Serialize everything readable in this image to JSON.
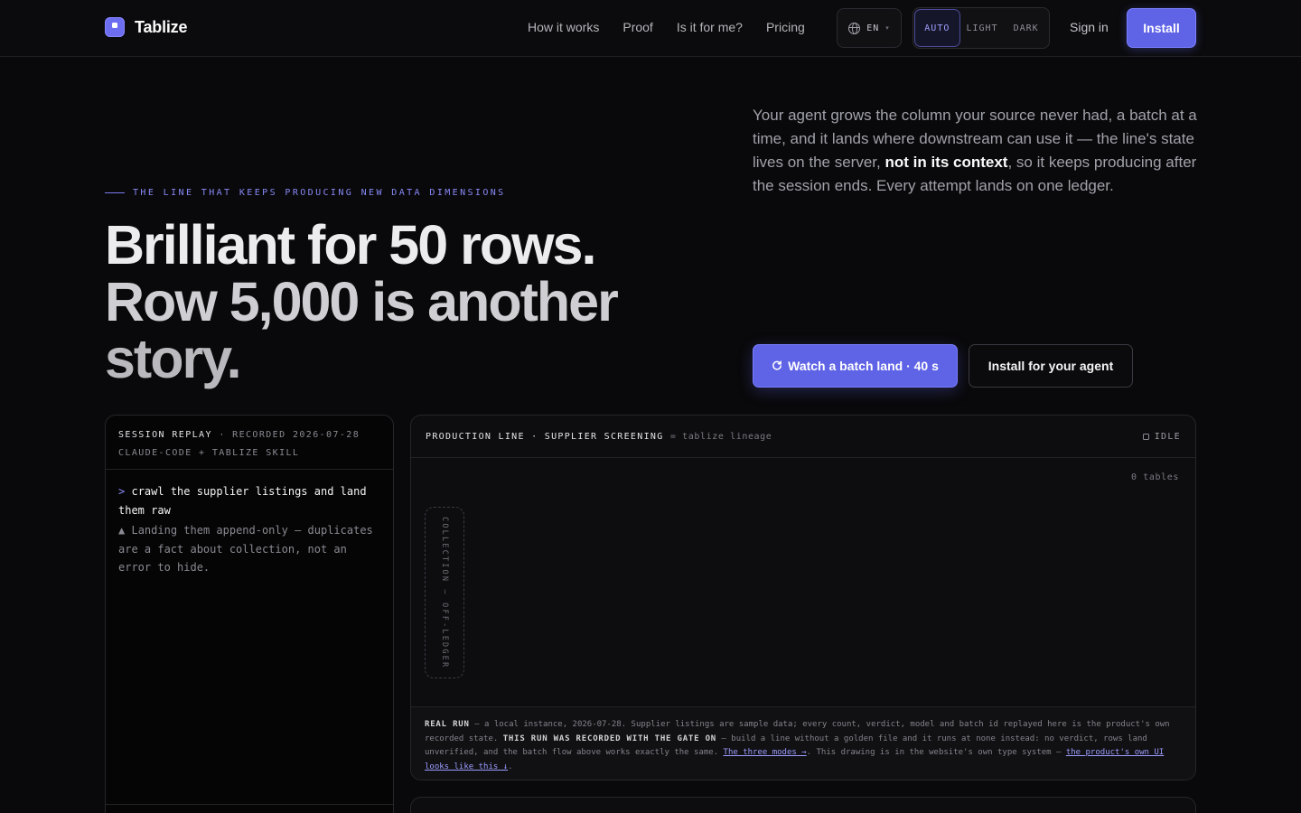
{
  "header": {
    "brand": "Tablize",
    "nav": [
      "How it works",
      "Proof",
      "Is it for me?",
      "Pricing"
    ],
    "language": "EN",
    "theme_options": [
      "AUTO",
      "LIGHT",
      "DARK"
    ],
    "theme_selected": "AUTO",
    "sign_in": "Sign in",
    "install": "Install"
  },
  "hero": {
    "eyebrow": "THE LINE THAT KEEPS PRODUCING NEW DATA DIMENSIONS",
    "headline": [
      "Brilliant for 50 rows.",
      "Row 5,000 is another",
      "story."
    ],
    "lede_before": "Your agent grows the column your source never had, a batch at a time, and it lands where downstream can use it — the line's state lives on the server, ",
    "lede_bold": "not in its context",
    "lede_after": ", so it keeps producing after the session ends. Every attempt lands on one ledger.",
    "cta_primary": "Watch a batch land · 40 s",
    "cta_secondary": "Install for your agent"
  },
  "session": {
    "label": "SESSION REPLAY",
    "recorded": "· RECORDED 2026-07-28",
    "agent": "CLAUDE-CODE + TABLIZE SKILL",
    "prompt_marker": ">",
    "prompt": "crawl the supplier listings and land them raw",
    "note_marker": "▲",
    "note": "Landing them append-only — duplicates are a fact about collection, not an error to hide."
  },
  "production": {
    "title": "PRODUCTION LINE · SUPPLIER SCREENING",
    "subtitle": "= tablize lineage",
    "status": "IDLE",
    "tables": "0 tables",
    "collection_label": "COLLECTION — OFF-LEDGER",
    "footer": {
      "lead": "REAL RUN",
      "text1": " — a local instance, 2026-07-28. Supplier listings are sample data; every count, verdict, model and batch id replayed here is the product's own recorded state. ",
      "bold2": "THIS RUN WAS RECORDED WITH THE GATE ON",
      "text2": " — build a line without a golden file and it runs at none instead: no verdict, rows land unverified, and the batch flow above works exactly the same. ",
      "link1": "The three modes →",
      "text3": ". This drawing is in the website's own type system — ",
      "link2": "the product's own UI looks like this ↓",
      "text4": "."
    }
  },
  "colors": {
    "accent": "#5f63e6",
    "background": "#09090b",
    "link": "#9c9cff"
  }
}
